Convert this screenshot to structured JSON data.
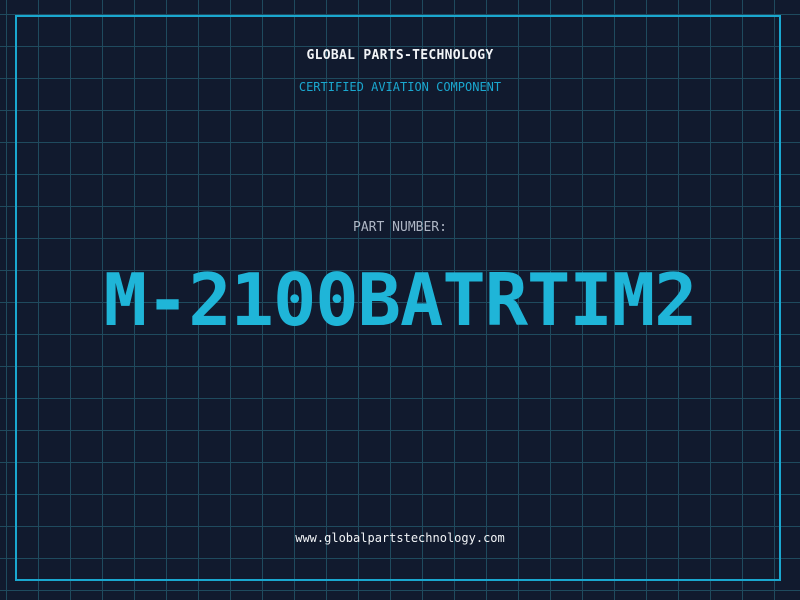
{
  "header": {
    "company_name": "GLOBAL PARTS-TECHNOLOGY",
    "tagline": "CERTIFIED AVIATION COMPONENT"
  },
  "part": {
    "label": "PART NUMBER:",
    "number": "M-2100BATRTIM2"
  },
  "footer": {
    "website": "www.globalpartstechnology.com"
  },
  "colors": {
    "background": "#111a2e",
    "grid": "#1f4a5e",
    "accent": "#1aa7cf",
    "text": "#f2f4f7"
  }
}
